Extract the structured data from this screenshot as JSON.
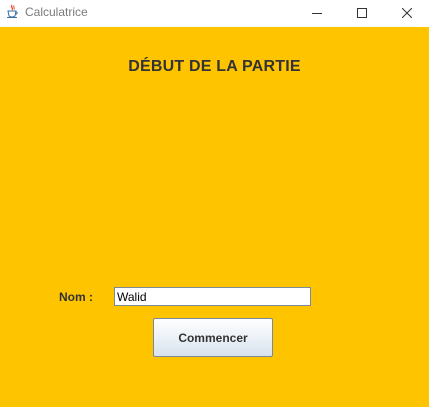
{
  "window": {
    "title": "Calculatrice",
    "app_icon": "java-cup-icon",
    "controls": {
      "minimize_icon": "minimize-icon",
      "maximize_icon": "maximize-icon",
      "close_icon": "close-icon"
    }
  },
  "main": {
    "heading": "DÉBUT DE LA PARTIE",
    "name_label": "Nom :",
    "name_value": "Walid",
    "start_button_label": "Commencer",
    "background_color": "#ffc400"
  }
}
